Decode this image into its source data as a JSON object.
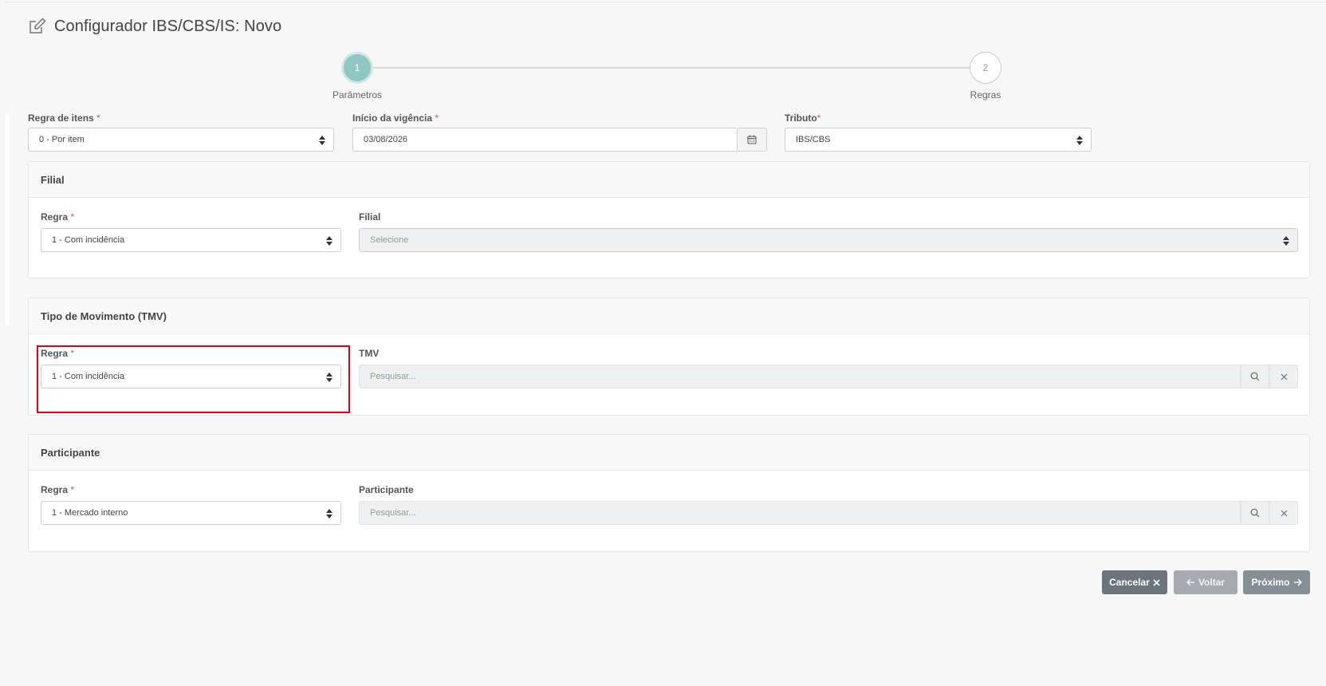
{
  "header": {
    "title": "Configurador IBS/CBS/IS: Novo",
    "icon": "edit-icon"
  },
  "stepper": {
    "steps": [
      {
        "number": "1",
        "label": "Parâmetros",
        "active": true
      },
      {
        "number": "2",
        "label": "Regras",
        "active": false
      }
    ]
  },
  "top_fields": {
    "regra_itens": {
      "label": "Regra de itens",
      "required_mark": "*",
      "value": "0 - Por item"
    },
    "inicio_vigencia": {
      "label": "Início da vigência",
      "required_mark": "*",
      "value": "03/08/2026"
    },
    "tributo": {
      "label": "Tributo",
      "required_mark": "*",
      "value": "IBS/CBS"
    }
  },
  "filial": {
    "title": "Filial",
    "regra_label": "Regra",
    "required_mark": "*",
    "regra_value": "1 - Com incidência",
    "filial_label": "Filial",
    "filial_placeholder": "Selecione"
  },
  "tmv": {
    "title": "Tipo de Movimento (TMV)",
    "regra_label": "Regra",
    "required_mark": "*",
    "regra_value": "1 - Com incidência",
    "tmv_label": "TMV",
    "search_placeholder": "Pesquisar..."
  },
  "participante": {
    "title": "Participante",
    "regra_label": "Regra",
    "required_mark": "*",
    "regra_value": "1 - Mercado interno",
    "participante_label": "Participante",
    "search_placeholder": "Pesquisar..."
  },
  "actions": {
    "cancel_label": "Cancelar",
    "back_label": "Voltar",
    "next_label": "Próximo"
  },
  "colors": {
    "step_active": "#8fc7c3",
    "required": "#d9534f",
    "highlight": "#e3000f",
    "btn_cancel": "#6c757d",
    "btn_back": "#a7abaf",
    "btn_next": "#868e96"
  }
}
